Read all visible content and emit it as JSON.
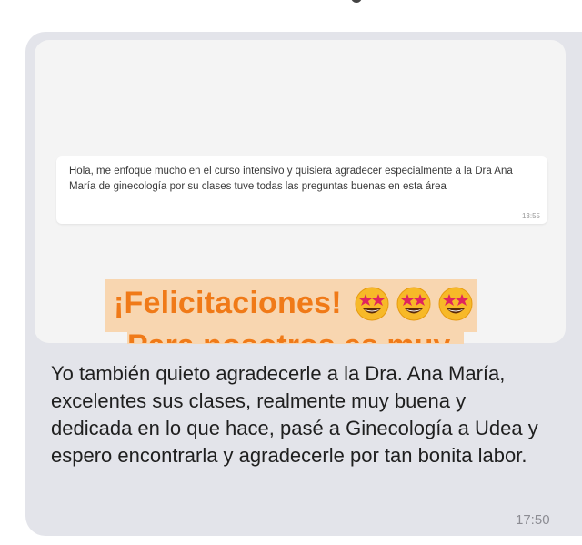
{
  "message": {
    "quoted_card": {
      "text": "Hola, me enfoque mucho en el curso intensivo y quisiera agradecer especialmente a la Dra Ana María de ginecología por su clases tuve todas las preguntas buenas en esta área",
      "time": "13:55"
    },
    "banner": {
      "headline": "¡Felicitaciones!",
      "emojis": [
        "star-struck-emoji",
        "star-struck-emoji",
        "star-struck-emoji"
      ],
      "partial_line": "Para nosotros es muy"
    },
    "text": "Yo también quieto agradecerle a la Dra. Ana María, excelentes sus clases, realmente muy buena y dedicada en lo que hace, pasé a Ginecología a Udea y espero encontrarla y agradecerle por tan bonita labor.",
    "time": "17:50"
  },
  "colors": {
    "bubble": "#e3e4ea",
    "banner_bg": "#f8d6b0",
    "banner_text": "#f07a18",
    "caption_text": "#1f1f1f",
    "time_text": "#8c8c93"
  }
}
